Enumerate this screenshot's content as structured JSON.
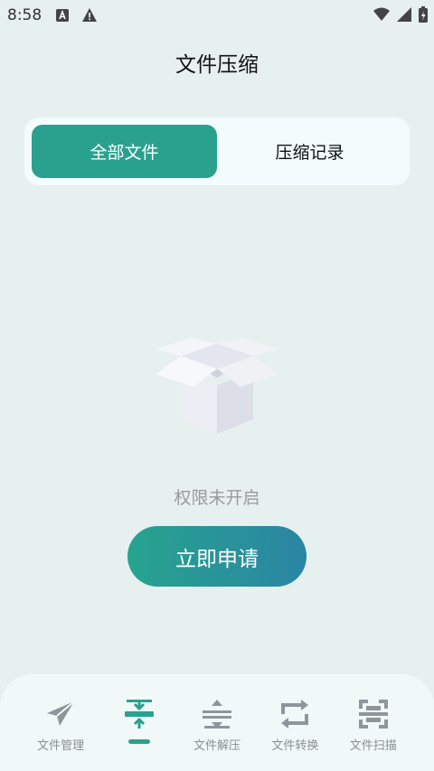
{
  "status_bar": {
    "time": "8:58"
  },
  "header": {
    "title": "文件压缩"
  },
  "tabs": [
    {
      "label": "全部文件",
      "active": true
    },
    {
      "label": "压缩记录",
      "active": false
    }
  ],
  "empty_state": {
    "icon": "empty-box-icon",
    "message": "权限未开启",
    "button_label": "立即申请"
  },
  "bottom_nav": {
    "items": [
      {
        "label": "文件管理",
        "icon": "paper-plane-icon",
        "active": false
      },
      {
        "label": "",
        "icon": "compress-icon",
        "active": true
      },
      {
        "label": "文件解压",
        "icon": "decompress-icon",
        "active": false
      },
      {
        "label": "文件转换",
        "icon": "convert-icon",
        "active": false
      },
      {
        "label": "文件扫描",
        "icon": "scan-icon",
        "active": false
      }
    ]
  },
  "colors": {
    "accent": "#2aa18e",
    "background": "#e6f0ef",
    "button_gradient_end": "#2a85a4"
  }
}
